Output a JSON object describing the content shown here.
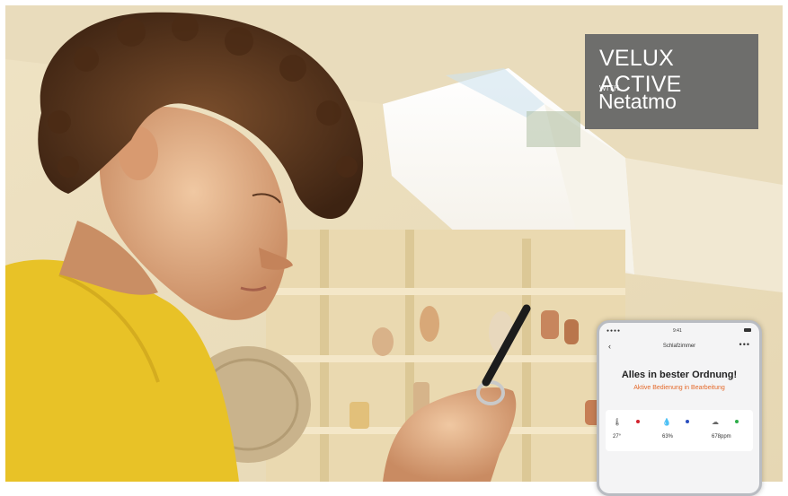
{
  "brand": {
    "title": "VELUX ACTIVE",
    "with": "WITH",
    "partner": "Netatmo"
  },
  "phone": {
    "status_time": "9:41",
    "status_dots": "●●●●",
    "back_label": "‹",
    "room": "Schlafzimmer",
    "more_label": "•••",
    "message": "Alles in bester Ordnung!",
    "submessage": "Aktive Bedienung in Bearbeitung",
    "sensors": [
      {
        "icon": "thermometer-icon",
        "glyph": "🌡",
        "value": "27°",
        "dot_color": "#d2222d"
      },
      {
        "icon": "humidity-icon",
        "glyph": "💧",
        "value": "63%",
        "dot_color": "#2b4fbf"
      },
      {
        "icon": "co2-icon",
        "glyph": "☁",
        "value": "678ppm",
        "dot_color": "#2fae4a"
      }
    ]
  },
  "colors": {
    "brand_box": "#6e6e6c",
    "accent_orange": "#e4692a",
    "shirt_yellow": "#e8c227"
  }
}
